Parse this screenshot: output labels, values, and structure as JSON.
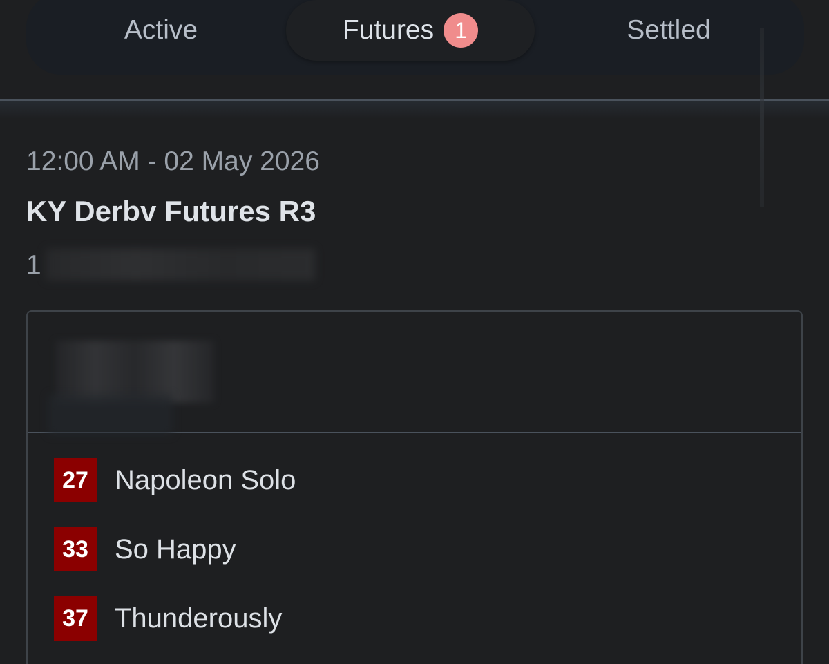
{
  "tabs": [
    {
      "label": "Active"
    },
    {
      "label": "Futures",
      "badge": "1"
    },
    {
      "label": "Settled"
    }
  ],
  "event": {
    "time": "12:00 AM - 02 May 2026",
    "title": "KY Derbv Futures R3",
    "subtitle": "1"
  },
  "runners": [
    {
      "number": "27",
      "name": "Napoleon Solo"
    },
    {
      "number": "33",
      "name": "So Happy"
    },
    {
      "number": "37",
      "name": "Thunderously"
    }
  ],
  "colors": {
    "background": "#1e1f21",
    "badge": "#f08c8c",
    "saddle_cloth": "#8b0000"
  }
}
